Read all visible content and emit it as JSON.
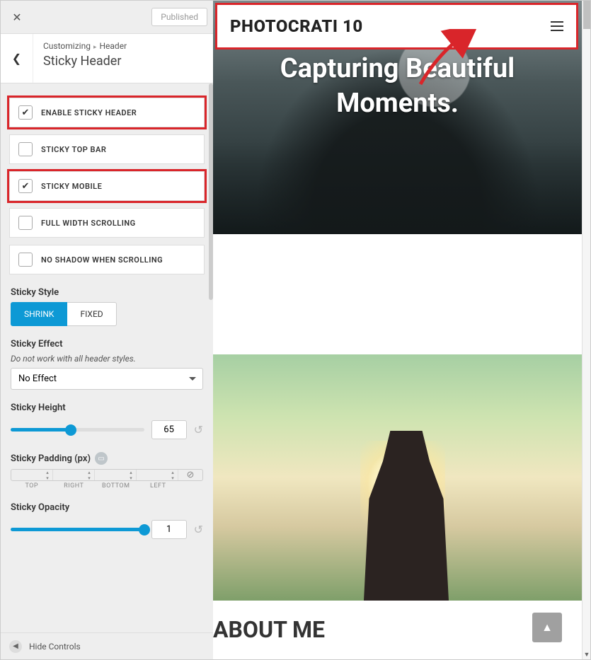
{
  "topbar": {
    "publish_label": "Published"
  },
  "breadcrumb": {
    "root": "Customizing",
    "parent": "Header",
    "title": "Sticky Header"
  },
  "options": [
    {
      "label": "ENABLE STICKY HEADER",
      "checked": true,
      "highlight": true
    },
    {
      "label": "STICKY TOP BAR",
      "checked": false,
      "highlight": false
    },
    {
      "label": "STICKY MOBILE",
      "checked": true,
      "highlight": true
    },
    {
      "label": "FULL WIDTH SCROLLING",
      "checked": false,
      "highlight": false
    },
    {
      "label": "NO SHADOW WHEN SCROLLING",
      "checked": false,
      "highlight": false
    }
  ],
  "sticky_style": {
    "label": "Sticky Style",
    "options": [
      "SHRINK",
      "FIXED"
    ],
    "active": "SHRINK"
  },
  "sticky_effect": {
    "label": "Sticky Effect",
    "hint": "Do not work with all header styles.",
    "value": "No Effect"
  },
  "sticky_height": {
    "label": "Sticky Height",
    "value": "65",
    "percent": 45
  },
  "sticky_padding": {
    "label": "Sticky Padding (px)",
    "sides": [
      "TOP",
      "RIGHT",
      "BOTTOM",
      "LEFT"
    ]
  },
  "sticky_opacity": {
    "label": "Sticky Opacity",
    "value": "1",
    "percent": 100
  },
  "footer": {
    "hide_label": "Hide Controls"
  },
  "preview": {
    "brand": "PHOTOCRATI 10",
    "hero_line1": "Capturing Beautiful",
    "hero_line2": "Moments.",
    "about_title": "ABOUT ME"
  }
}
